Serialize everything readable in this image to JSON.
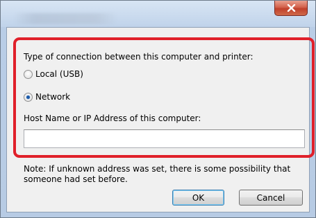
{
  "dialog": {
    "close_icon": "close-icon",
    "connection_label": "Type of connection between this computer and printer:",
    "options": [
      {
        "label": "Local (USB)",
        "selected": false
      },
      {
        "label": "Network",
        "selected": true
      }
    ],
    "host_label": "Host Name or IP Address of this computer:",
    "host_value": "",
    "note_line1": "Note: If unknown address was set, there is some possibility that",
    "note_line2": "someone had set before.",
    "ok_label": "OK",
    "cancel_label": "Cancel"
  },
  "colors": {
    "highlight_border": "#e0202a",
    "close_button": "#c0402b",
    "radio_selected": "#1c5aa8"
  }
}
